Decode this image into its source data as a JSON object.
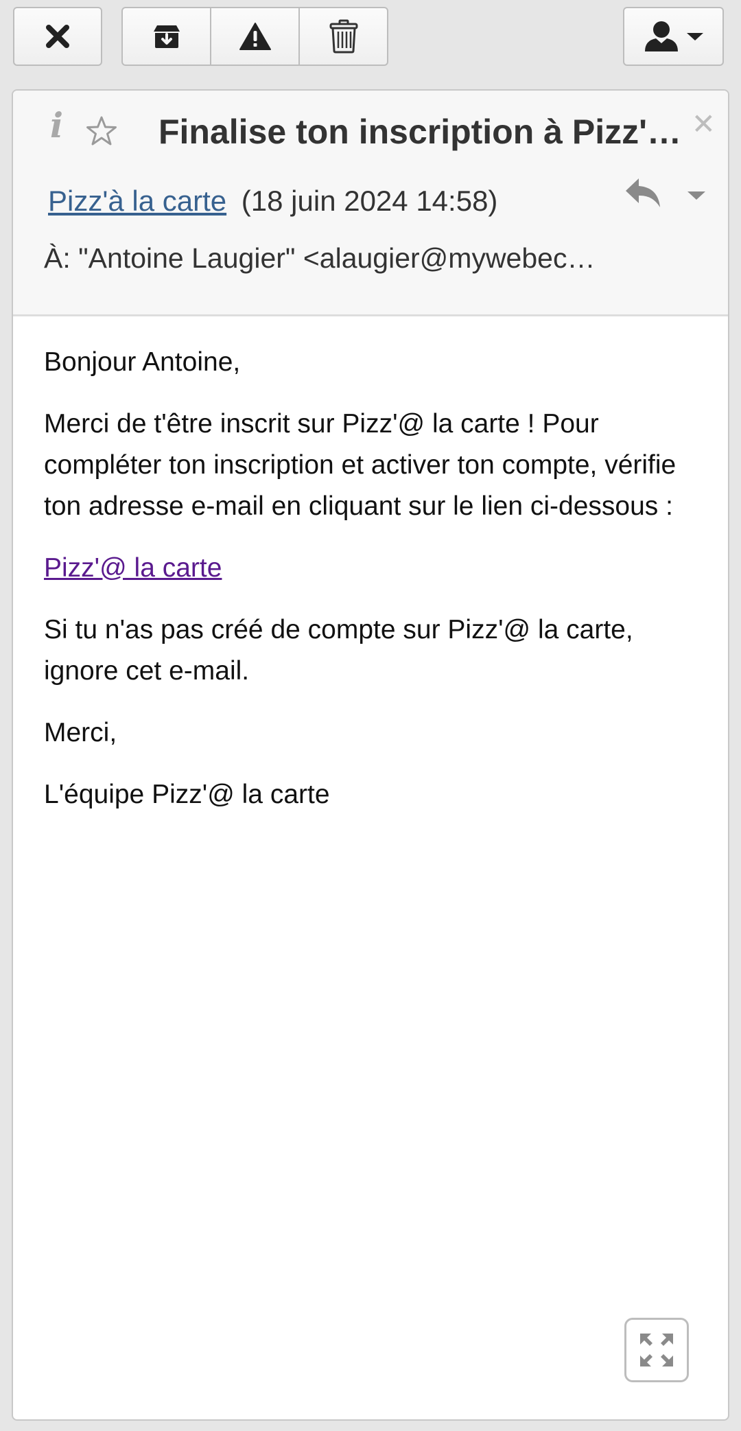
{
  "toolbar": {
    "close_icon": "close-icon",
    "archive_icon": "archive-icon",
    "spam_icon": "warning-icon",
    "delete_icon": "trash-icon",
    "account_icon": "user-icon"
  },
  "message": {
    "subject": "Finalise ton inscription à Pizz'à la carte",
    "sender_name": "Pizz'à la carte",
    "date": "(18 juin 2024 14:58)",
    "to_line": "À: \"Antoine Laugier\" <alaugier@mywebecole.fr>"
  },
  "body": {
    "greeting": "Bonjour Antoine,",
    "paragraph1": "Merci de t'être inscrit sur Pizz'@ la carte ! Pour compléter ton inscription et activer ton compte, vérifie ton adresse e-mail en cliquant sur le lien ci-dessous :",
    "link_text": "Pizz'@ la carte",
    "paragraph2": "Si tu n'as pas créé de compte sur Pizz'@ la carte, ignore cet e-mail.",
    "thanks": "Merci,",
    "signature": "L'équipe Pizz'@ la carte"
  },
  "colors": {
    "sender_link": "#37618f",
    "body_link": "#5a1a8e",
    "toolbar_bg": "#f4f4f4",
    "header_bg": "#f7f7f7"
  }
}
